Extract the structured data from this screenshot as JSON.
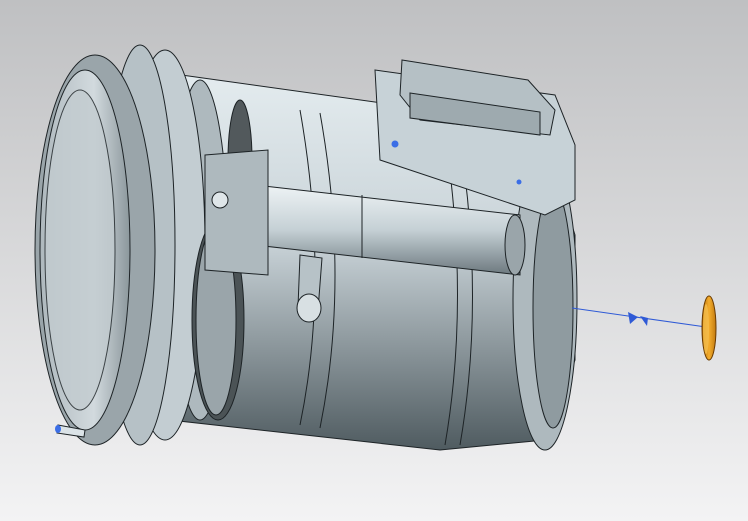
{
  "viewport": {
    "background_top": "#bfc0c2",
    "background_bottom": "#f3f3f4"
  },
  "model": {
    "body_color": "#c9d3d8",
    "body_shadow": "#4f5b60",
    "edge_color": "#1d2326",
    "accent_blue": "#3b6ee6",
    "part_color": "#e59a1d"
  },
  "annotations": {
    "dimension_color": "#2f5ad6"
  }
}
